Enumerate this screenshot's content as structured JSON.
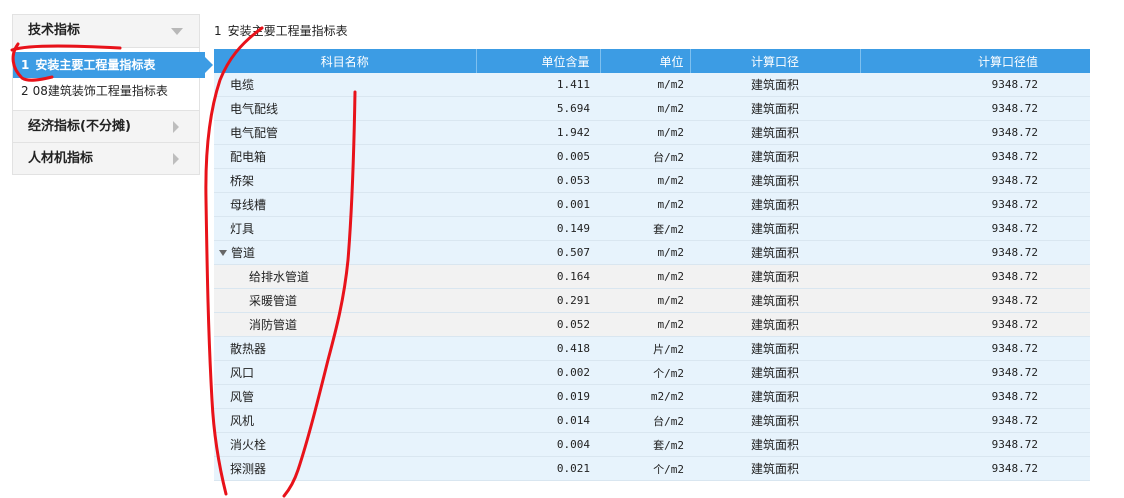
{
  "sidebar": {
    "section_title": "技术指标",
    "items": [
      {
        "index": "1",
        "label": "安装主要工程量指标表",
        "active": true
      },
      {
        "index": "2",
        "label": "08建筑装饰工程量指标表",
        "active": false
      }
    ],
    "groups": [
      {
        "label": "经济指标(不分摊)"
      },
      {
        "label": "人材机指标"
      }
    ]
  },
  "main": {
    "title_index": "1",
    "title": "安装主要工程量指标表",
    "columns": [
      "科目名称",
      "单位含量",
      "单位",
      "计算口径",
      "计算口径值"
    ],
    "rows": [
      {
        "name": "电缆",
        "qty": "1.411",
        "unit": "m/m2",
        "basis": "建筑面积",
        "value": "9348.72",
        "level": 0
      },
      {
        "name": "电气配线",
        "qty": "5.694",
        "unit": "m/m2",
        "basis": "建筑面积",
        "value": "9348.72",
        "level": 0
      },
      {
        "name": "电气配管",
        "qty": "1.942",
        "unit": "m/m2",
        "basis": "建筑面积",
        "value": "9348.72",
        "level": 0
      },
      {
        "name": "配电箱",
        "qty": "0.005",
        "unit": "台/m2",
        "basis": "建筑面积",
        "value": "9348.72",
        "level": 0
      },
      {
        "name": "桥架",
        "qty": "0.053",
        "unit": "m/m2",
        "basis": "建筑面积",
        "value": "9348.72",
        "level": 0
      },
      {
        "name": "母线槽",
        "qty": "0.001",
        "unit": "m/m2",
        "basis": "建筑面积",
        "value": "9348.72",
        "level": 0
      },
      {
        "name": "灯具",
        "qty": "0.149",
        "unit": "套/m2",
        "basis": "建筑面积",
        "value": "9348.72",
        "level": 0
      },
      {
        "name": "管道",
        "qty": "0.507",
        "unit": "m/m2",
        "basis": "建筑面积",
        "value": "9348.72",
        "level": 0,
        "expanded": true
      },
      {
        "name": "给排水管道",
        "qty": "0.164",
        "unit": "m/m2",
        "basis": "建筑面积",
        "value": "9348.72",
        "level": 1
      },
      {
        "name": "采暖管道",
        "qty": "0.291",
        "unit": "m/m2",
        "basis": "建筑面积",
        "value": "9348.72",
        "level": 1
      },
      {
        "name": "消防管道",
        "qty": "0.052",
        "unit": "m/m2",
        "basis": "建筑面积",
        "value": "9348.72",
        "level": 1
      },
      {
        "name": "散热器",
        "qty": "0.418",
        "unit": "片/m2",
        "basis": "建筑面积",
        "value": "9348.72",
        "level": 0
      },
      {
        "name": "风口",
        "qty": "0.002",
        "unit": "个/m2",
        "basis": "建筑面积",
        "value": "9348.72",
        "level": 0
      },
      {
        "name": "风管",
        "qty": "0.019",
        "unit": "m2/m2",
        "basis": "建筑面积",
        "value": "9348.72",
        "level": 0
      },
      {
        "name": "风机",
        "qty": "0.014",
        "unit": "台/m2",
        "basis": "建筑面积",
        "value": "9348.72",
        "level": 0
      },
      {
        "name": "消火栓",
        "qty": "0.004",
        "unit": "套/m2",
        "basis": "建筑面积",
        "value": "9348.72",
        "level": 0
      },
      {
        "name": "探测器",
        "qty": "0.021",
        "unit": "个/m2",
        "basis": "建筑面积",
        "value": "9348.72",
        "level": 0
      }
    ]
  },
  "colors": {
    "accent": "#3c9ce4",
    "row_bg": "#e7f3fc",
    "child_row_bg": "#f2f2f2",
    "annotation": "#e8121a"
  }
}
